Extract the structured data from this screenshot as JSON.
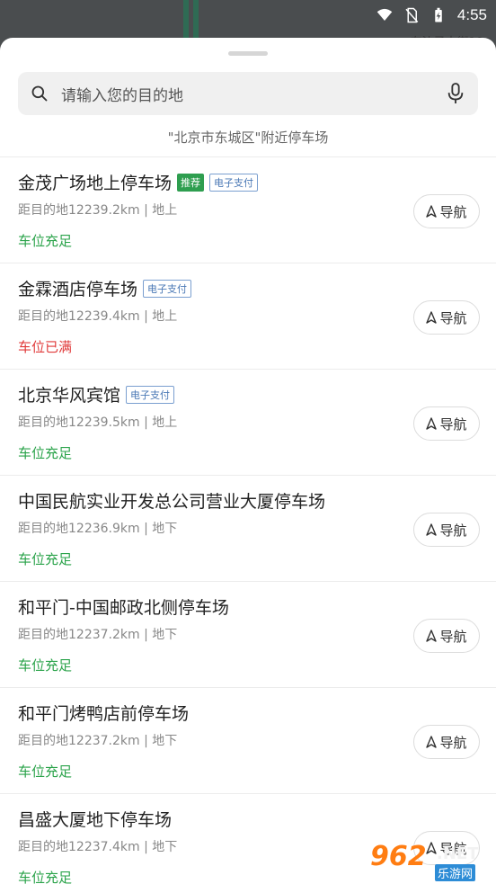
{
  "status_bar": {
    "time": "4:55"
  },
  "map": {
    "partial_text": "东沙子大街10"
  },
  "search": {
    "placeholder": "请输入您的目的地"
  },
  "nearby_label": "\"北京市东城区\"附近停车场",
  "nav_label": "导航",
  "tags": {
    "recommend": "推荐",
    "e_pay": "电子支付"
  },
  "items": [
    {
      "name": "金茂广场地上停车场",
      "recommend": true,
      "e_pay": true,
      "distance": "距目的地12239.2km | 地上",
      "status": "车位充足",
      "full": false
    },
    {
      "name": "金霖酒店停车场",
      "recommend": false,
      "e_pay": true,
      "distance": "距目的地12239.4km | 地上",
      "status": "车位已满",
      "full": true
    },
    {
      "name": "北京华风宾馆",
      "recommend": false,
      "e_pay": true,
      "distance": "距目的地12239.5km | 地上",
      "status": "车位充足",
      "full": false
    },
    {
      "name": "中国民航实业开发总公司营业大厦停车场",
      "recommend": false,
      "e_pay": false,
      "distance": "距目的地12236.9km | 地下",
      "status": "车位充足",
      "full": false
    },
    {
      "name": "和平门-中国邮政北侧停车场",
      "recommend": false,
      "e_pay": false,
      "distance": "距目的地12237.2km | 地下",
      "status": "车位充足",
      "full": false
    },
    {
      "name": "和平门烤鸭店前停车场",
      "recommend": false,
      "e_pay": false,
      "distance": "距目的地12237.2km | 地下",
      "status": "车位充足",
      "full": false
    },
    {
      "name": "昌盛大厦地下停车场",
      "recommend": false,
      "e_pay": false,
      "distance": "距目的地12237.4km | 地下",
      "status": "车位充足",
      "full": false
    }
  ],
  "watermark": {
    "brand": "962",
    "suffix": ".NET",
    "site": "乐游网"
  },
  "colors": {
    "available": "#2aa34a",
    "full": "#e03a3a",
    "recommend_tag": "#2e9e4f",
    "pay_tag": "#4a78b5"
  },
  "icons": [
    "wifi-icon",
    "no-sim-icon",
    "battery-icon",
    "search-icon",
    "microphone-icon",
    "navigation-arrow-icon"
  ]
}
